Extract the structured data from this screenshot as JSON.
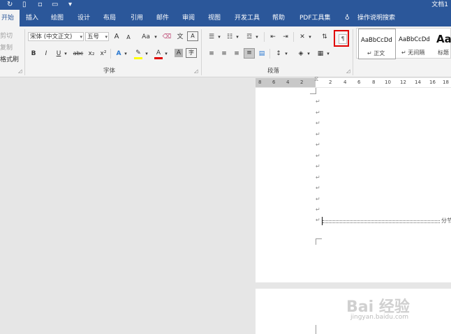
{
  "titlebar": {
    "doc_title": "文档1",
    "customize_glyph": "▾"
  },
  "tabs": [
    {
      "label": "开始"
    },
    {
      "label": "插入"
    },
    {
      "label": "绘图"
    },
    {
      "label": "设计"
    },
    {
      "label": "布局"
    },
    {
      "label": "引用"
    },
    {
      "label": "邮件"
    },
    {
      "label": "审阅"
    },
    {
      "label": "视图"
    },
    {
      "label": "开发工具"
    },
    {
      "label": "帮助"
    },
    {
      "label": "PDF工具集"
    },
    {
      "label": "操作说明搜索"
    }
  ],
  "clipboard": {
    "cut": "剪切",
    "copy": "复制",
    "format_painter": "格式刷"
  },
  "font": {
    "name": "宋体 (中文正文)",
    "size": "五号",
    "group_label": "字体",
    "grow": "A",
    "shrink": "A",
    "change_case": "Aa",
    "bold": "B",
    "italic": "I",
    "underline": "U",
    "strike": "abc",
    "subscript": "x₂",
    "superscript": "x²",
    "text_effect": "A",
    "font_color": "A",
    "char_shading": "A",
    "char_border": "A",
    "phonetic": "文"
  },
  "paragraph": {
    "group_label": "段落"
  },
  "styles": [
    {
      "sample": "AaBbCcDd",
      "name": "正文"
    },
    {
      "sample": "AaBbCcDd",
      "name": "无间隔"
    },
    {
      "sample": "Aa",
      "name": "标题"
    }
  ],
  "ruler": {
    "labels": [
      "8",
      "6",
      "4",
      "2",
      "2",
      "4",
      "6",
      "8",
      "10",
      "12",
      "14",
      "16",
      "18"
    ]
  },
  "document": {
    "paragraph_mark": "↵",
    "section_break_label": "分节"
  },
  "watermark": {
    "brand": "Bai 经验",
    "url": "jingyan.baidu.com"
  },
  "colors": {
    "accent": "#2b579a",
    "highlight_box": "#e00000",
    "font_color_bar": "#e00000",
    "highlight_bar": "#ffff00"
  }
}
